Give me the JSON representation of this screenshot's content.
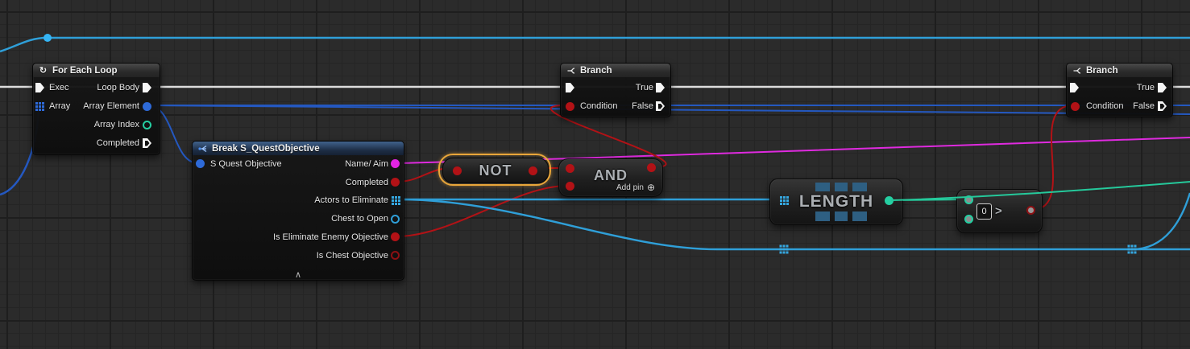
{
  "colors": {
    "exec_white": "#dcdcdc",
    "bool_red": "#b21216",
    "struct_blue": "#2458c0",
    "actor_cyan": "#2f9fd8",
    "int_green": "#25c99b",
    "string_magenta": "#df2adf",
    "selection_orange": "#e9a63a",
    "length_watermark": "#2e5f82"
  },
  "icons": {
    "loop": "↻",
    "collapse": "∧",
    "add_pin": "⊕"
  },
  "nodes": {
    "for_each_loop": {
      "title": "For Each Loop",
      "pins": {
        "exec": "Exec",
        "array": "Array",
        "loop_body": "Loop Body",
        "array_element": "Array Element",
        "array_index": "Array Index",
        "completed": "Completed"
      }
    },
    "break_quest": {
      "title": "Break S_QuestObjective",
      "pins": {
        "s_quest_objective": "S Quest Objective",
        "name_aim": "Name/ Aim",
        "completed": "Completed",
        "actors_to_eliminate": "Actors to Eliminate",
        "chest_to_open": "Chest to Open",
        "is_eliminate_enemy_objective": "Is Eliminate Enemy Objective",
        "is_chest_objective": "Is Chest Objective"
      }
    },
    "not_node": {
      "label": "NOT"
    },
    "and_node": {
      "label": "AND",
      "add_pin_label": "Add pin"
    },
    "branch_1": {
      "title": "Branch",
      "condition": "Condition",
      "true_label": "True",
      "false_label": "False"
    },
    "branch_2": {
      "title": "Branch",
      "condition": "Condition",
      "true_label": "True",
      "false_label": "False"
    },
    "length_node": {
      "label": "LENGTH"
    },
    "greater_node": {
      "operator": ">",
      "input_value": "0"
    }
  }
}
